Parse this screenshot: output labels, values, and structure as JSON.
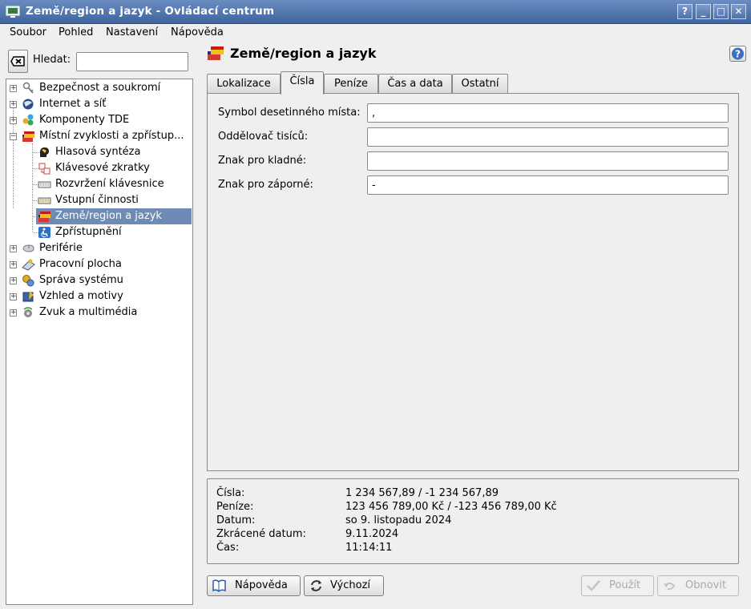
{
  "window": {
    "title": "Země/region a jazyk - Ovládací centrum",
    "buttons": {
      "help": "?",
      "minimize": "_",
      "maximize": "□",
      "close": "✕"
    }
  },
  "menubar": {
    "items": [
      "Soubor",
      "Pohled",
      "Nastavení",
      "Nápověda"
    ]
  },
  "search": {
    "label": "Hledat:",
    "value": "",
    "placeholder": ""
  },
  "tree": {
    "items": [
      {
        "label": "Bezpečnost a soukromí",
        "icon": "keys-icon",
        "level": 0,
        "expander": "+"
      },
      {
        "label": "Internet a síť",
        "icon": "globe-icon",
        "level": 0,
        "expander": "+"
      },
      {
        "label": "Komponenty TDE",
        "icon": "components-icon",
        "level": 0,
        "expander": "+"
      },
      {
        "label": "Místní zvyklosti a zpřístup...",
        "icon": "flags-icon",
        "level": 0,
        "expander": "−"
      },
      {
        "label": "Hlasová syntéza",
        "icon": "speech-icon",
        "level": 1
      },
      {
        "label": "Klávesové zkratky",
        "icon": "shortcuts-icon",
        "level": 1
      },
      {
        "label": "Rozvržení klávesnice",
        "icon": "keyboard-icon",
        "level": 1
      },
      {
        "label": "Vstupní činnosti",
        "icon": "keyboard-icon",
        "level": 1
      },
      {
        "label": "Země/region a jazyk",
        "icon": "flags-icon",
        "level": 1,
        "selected": true
      },
      {
        "label": "Zpřístupnění",
        "icon": "accessibility-icon",
        "level": 1
      },
      {
        "label": "Periférie",
        "icon": "mouse-icon",
        "level": 0,
        "expander": "+"
      },
      {
        "label": "Pracovní plocha",
        "icon": "desktop-icon",
        "level": 0,
        "expander": "+"
      },
      {
        "label": "Správa systému",
        "icon": "system-icon",
        "level": 0,
        "expander": "+"
      },
      {
        "label": "Vzhled a motivy",
        "icon": "appearance-icon",
        "level": 0,
        "expander": "+"
      },
      {
        "label": "Zvuk a multimédia",
        "icon": "sound-icon",
        "level": 0,
        "expander": "+"
      }
    ]
  },
  "page": {
    "title": "Země/region a jazyk"
  },
  "tabs": [
    "Lokalizace",
    "Čísla",
    "Peníze",
    "Čas a data",
    "Ostatní"
  ],
  "active_tab": "Čísla",
  "fields": [
    {
      "label": "Symbol desetinného místa:",
      "value": ","
    },
    {
      "label": "Oddělovač tisíců:",
      "value": ""
    },
    {
      "label": "Znak pro kladné:",
      "value": ""
    },
    {
      "label": "Znak pro záporné:",
      "value": "-"
    }
  ],
  "preview": [
    {
      "label": "Čísla:",
      "value": "1 234 567,89 / -1 234 567,89"
    },
    {
      "label": "Peníze:",
      "value": "123 456 789,00 Kč / -123 456 789,00 Kč"
    },
    {
      "label": "Datum:",
      "value": "so 9. listopadu 2024"
    },
    {
      "label": "Zkrácené datum:",
      "value": "9.11.2024"
    },
    {
      "label": "Čas:",
      "value": "11:14:11"
    }
  ],
  "buttons": {
    "help": "Nápověda",
    "defaults": "Výchozí",
    "apply": "Použít",
    "reset": "Obnovit"
  },
  "colors": {
    "titlebar": "#4f74ad",
    "selection": "#6d8bb5",
    "background": "#efefef"
  }
}
